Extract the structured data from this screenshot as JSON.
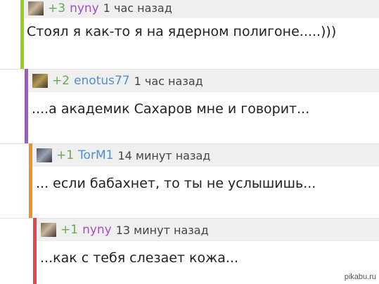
{
  "comments": [
    {
      "rating": "+3",
      "user": "nyny",
      "user_color": "#a64dc8",
      "time": "1 час назад",
      "text": "Стоял я как-то я на ядерном полигоне.....)))",
      "bar_color": "#9ccc24"
    },
    {
      "rating": "+2",
      "user": "enotus77",
      "user_color": "#4f8fd1",
      "time": "1 час назад",
      "text": "....а академик Сахаров мне и говорит...",
      "bar_color": "#a05ac8"
    },
    {
      "rating": "+1",
      "user": "TorM1",
      "user_color": "#4f8fd1",
      "time": "14 минут назад",
      "text": "... если бабахнет, то ты не услышишь...",
      "bar_color": "#f0922a"
    },
    {
      "rating": "+1",
      "user": "nyny",
      "user_color": "#a64dc8",
      "time": "13 минут назад",
      "text": "...как с тебя слезает кожа...",
      "bar_color": "#e24a4a"
    }
  ],
  "watermark": "pikabu.ru"
}
